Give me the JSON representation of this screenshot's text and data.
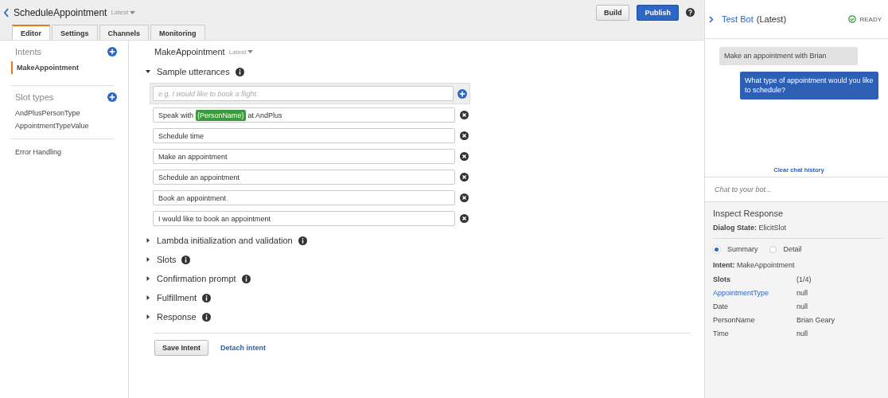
{
  "header": {
    "title": "ScheduleAppointment",
    "version": "Latest",
    "buttons": [
      {
        "label": "Build",
        "kind": "default"
      },
      {
        "label": "Publish",
        "kind": "primary"
      }
    ]
  },
  "tabs": [
    {
      "label": "Editor",
      "selected": true
    },
    {
      "label": "Settings",
      "selected": false
    },
    {
      "label": "Channels",
      "selected": false
    },
    {
      "label": "Monitoring",
      "selected": false
    }
  ],
  "sidebar": {
    "groups": [
      {
        "title": "Intents",
        "items": [
          {
            "label": "MakeAppointment",
            "selected": true
          }
        ]
      },
      {
        "title": "Slot types",
        "items": [
          {
            "label": "AndPlusPersonType",
            "selected": false
          },
          {
            "label": "AppointmentTypeValue",
            "selected": false
          }
        ]
      }
    ],
    "footer_link": "Error Handling"
  },
  "intent": {
    "name": "MakeAppointment",
    "version": "Latest",
    "sections": [
      {
        "title": "Sample utterances",
        "expanded": true
      },
      {
        "title": "Lambda initialization and validation",
        "expanded": false
      },
      {
        "title": "Slots",
        "expanded": false
      },
      {
        "title": "Confirmation prompt",
        "expanded": false
      },
      {
        "title": "Fulfillment",
        "expanded": false
      },
      {
        "title": "Response",
        "expanded": false
      }
    ],
    "new_utterance": {
      "placeholder": "e.g. I would like to book a flight."
    },
    "utterances": [
      [
        {
          "kind": "text",
          "text": "Speak with"
        },
        {
          "kind": "slot",
          "text": "{PersonName}"
        },
        {
          "kind": "text",
          "text": "at AndPlus"
        }
      ],
      [
        {
          "kind": "text",
          "text": "Schedule time"
        }
      ],
      [
        {
          "kind": "text",
          "text": "Make an appointment"
        }
      ],
      [
        {
          "kind": "text",
          "text": "Schedule an appointment"
        }
      ],
      [
        {
          "kind": "text",
          "text": "Book an appointment"
        }
      ],
      [
        {
          "kind": "text",
          "text": "I would like to book an appointment"
        }
      ]
    ],
    "save_button": "Save Intent",
    "detach_link": "Detach intent"
  },
  "test_bot": {
    "title": "Test Bot",
    "version": "(Latest)",
    "status": "READY",
    "messages": [
      {
        "kind": "user",
        "text": "Make an appointment with Brian"
      },
      {
        "kind": "bot",
        "text": "What type of appointment would you like to schedule?"
      }
    ],
    "clear_link": "Clear chat history",
    "input": {
      "placeholder": "Chat to your bot..."
    }
  },
  "inspect": {
    "title": "Inspect Response",
    "dialog_state_label": "Dialog State:",
    "dialog_state": "ElicitSlot",
    "views": [
      {
        "label": "Summary",
        "selected": true
      },
      {
        "label": "Detail",
        "selected": false
      }
    ],
    "intent_label": "Intent:",
    "intent": "MakeAppointment",
    "slots_label": "Slots",
    "slots_count": "(1/4)",
    "slots": [
      {
        "name": "AppointmentType",
        "value": "null",
        "selected": true
      },
      {
        "name": "Date",
        "value": "null",
        "selected": false
      },
      {
        "name": "PersonName",
        "value": "Brian Geary",
        "selected": false
      },
      {
        "name": "Time",
        "value": "null",
        "selected": false
      }
    ]
  }
}
